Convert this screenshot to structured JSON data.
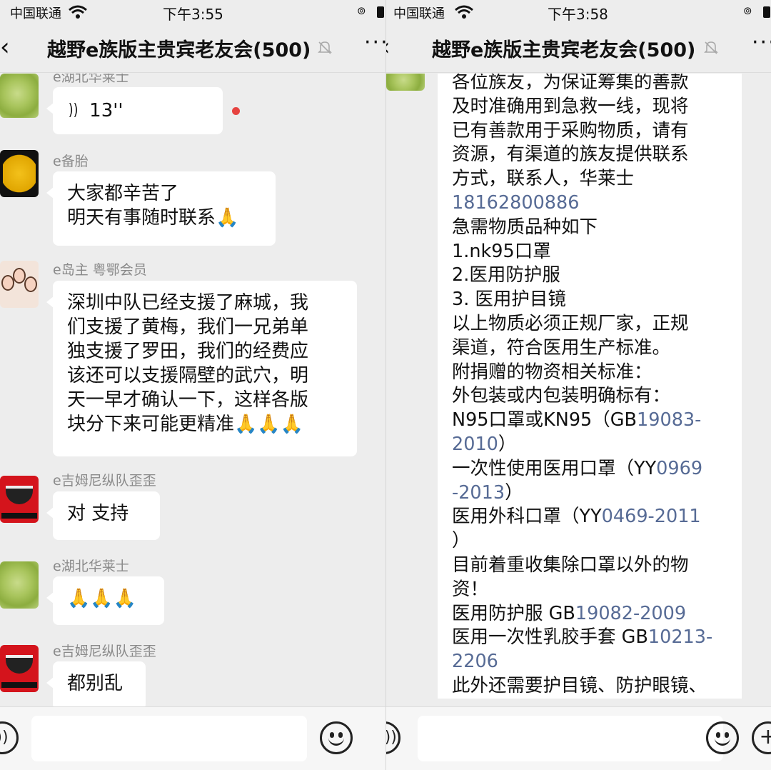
{
  "left": {
    "status": {
      "carrier": "中国联通",
      "time": "下午3:55"
    },
    "nav": {
      "back_glyph": "‹",
      "title": "越野e族版主贵宾老友会(500)",
      "more": "···"
    },
    "messages": [
      {
        "sender": "e湖北华莱士",
        "voice_duration": "13''"
      },
      {
        "sender": "e备胎",
        "lines": [
          "大家都辛苦了",
          "明天有事随时联系🙏"
        ]
      },
      {
        "sender": "e岛主  粤鄂会员",
        "lines": [
          "深圳中队已经支援了麻城，我",
          "们支援了黄梅，我们一兄弟单",
          "独支援了罗田，我们的经费应",
          "该还可以支援隔壁的武穴，明",
          "天一早才确认一下，这样各版",
          "块分下来可能更精准🙏🙏🙏"
        ]
      },
      {
        "sender": "e吉姆尼纵队歪歪",
        "lines": [
          "对  支持"
        ]
      },
      {
        "sender": "e湖北华莱士",
        "lines": [
          "🙏🙏🙏"
        ]
      },
      {
        "sender": "e吉姆尼纵队歪歪",
        "lines": [
          "都别乱"
        ]
      }
    ]
  },
  "right": {
    "status": {
      "carrier": "中国联通",
      "time": "下午3:58"
    },
    "nav": {
      "title": "越野e族版主贵宾老友会(500)",
      "more": "···"
    },
    "text": {
      "l1": "各位族友，为保证筹集的善款",
      "l2": "及时准确用到急救一线，现将",
      "l3": "已有善款用于采购物质，请有",
      "l4": "资源，有渠道的族友提供联系",
      "l5": "方式，联系人，华莱士",
      "l6": "18162800886",
      "l7": "急需物质品种如下",
      "l8": "1.nk95口罩",
      "l9": "2.医用防护服",
      "l10": "3.  医用护目镜",
      "l11": "以上物质必须正规厂家，正规",
      "l12": "渠道，符合医用生产标准。",
      "l13": "附捐赠的物资相关标准：",
      "l14": "外包装或内包装明确标有：",
      "l15a": "N95口罩或KN95（GB",
      "l15b": "19083-",
      "l16a": "2010",
      "l16b": "）",
      "l17a": "一次性使用医用口罩（YY",
      "l17b": "0969",
      "l18a": "-2013",
      "l18b": "）",
      "l19a": "医用外科口罩（YY",
      "l19b": "0469-2011",
      "l20": "）",
      "l21": "目前着重收集除口罩以外的物",
      "l22": "资！",
      "l23a": "医用防护服 GB",
      "l23b": "19082-2009",
      "l24a": "医用一次性乳胶手套 GB",
      "l24b": "10213-",
      "l25": "2206",
      "l26": "此外还需要护目镜、防护眼镜、"
    }
  },
  "colors": {
    "link": "#576b95",
    "unread": "#e64340",
    "bubble": "#ffffff",
    "bg": "#ededed"
  }
}
